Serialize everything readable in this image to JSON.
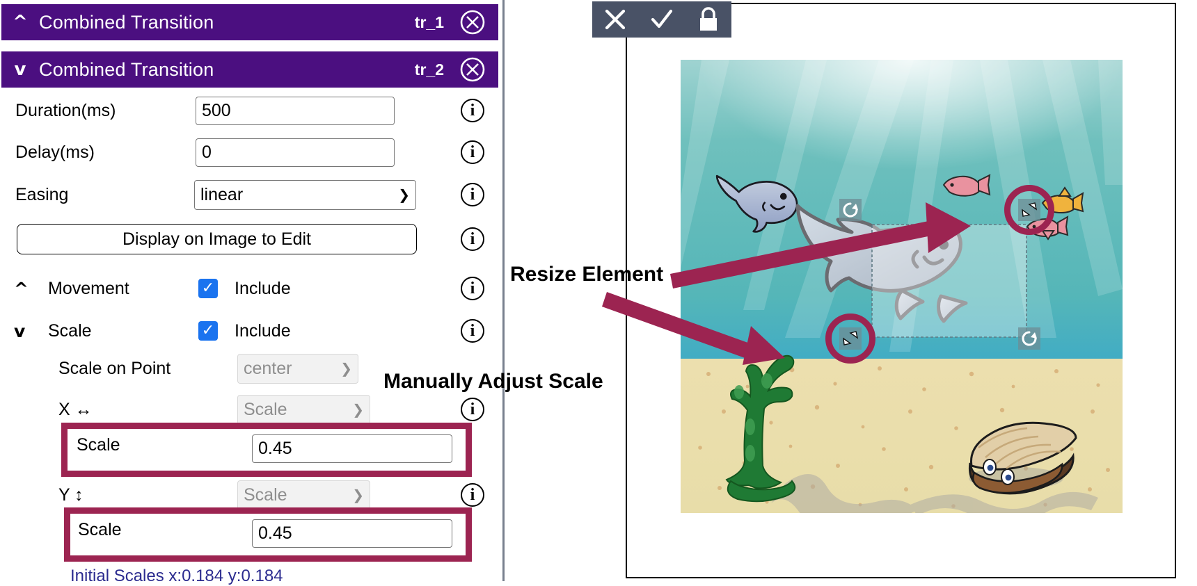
{
  "panel": {
    "transitions": [
      {
        "chevron": "^",
        "title": "Combined Transition",
        "id": "tr_1",
        "close": "close-icon",
        "expanded": false
      },
      {
        "chevron": "v",
        "title": "Combined Transition",
        "id": "tr_2",
        "close": "close-icon",
        "expanded": true
      }
    ],
    "fields": {
      "duration_label": "Duration(ms)",
      "duration_value": "500",
      "delay_label": "Delay(ms)",
      "delay_value": "0",
      "easing_label": "Easing",
      "easing_value": "linear",
      "display_button": "Display on Image to Edit",
      "info": "i"
    },
    "sections": {
      "movement_label": "Movement",
      "movement_chevron": "^",
      "movement_include": "Include",
      "movement_checked": "✓",
      "scale_label": "Scale",
      "scale_chevron": "v",
      "scale_include": "Include",
      "scale_checked": "✓"
    },
    "scale": {
      "scale_on_point_label": "Scale on Point",
      "scale_on_point_value": "center",
      "x_label": "X ↔",
      "x_type_value": "Scale",
      "x_scale_label": "Scale",
      "x_scale_value": "0.45",
      "y_label": "Y ↕",
      "y_type_value": "Scale",
      "y_scale_label": "Scale",
      "y_scale_value": "0.45",
      "initial_scales": "Initial Scales x:0.184 y:0.184"
    }
  },
  "annotations": {
    "manually_adjust_scale": "Manually Adjust Scale",
    "resize_element": "Resize Element"
  },
  "image_editor": {
    "toolbar": [
      {
        "name": "cancel-icon",
        "glyph": "✕"
      },
      {
        "name": "confirm-icon",
        "glyph": "✓"
      },
      {
        "name": "lock-icon",
        "glyph": "lock"
      }
    ],
    "handles": {
      "rotate": "rotate-handle",
      "resize": "resize-handle"
    }
  },
  "colors": {
    "header_purple": "#4b0f80",
    "highlight_crimson": "#9c2451",
    "toolbar_slate": "#495266",
    "checkbox_blue": "#1a73ef",
    "initial_scales_text": "#2b2b8f",
    "divider_gray": "#78808e"
  }
}
